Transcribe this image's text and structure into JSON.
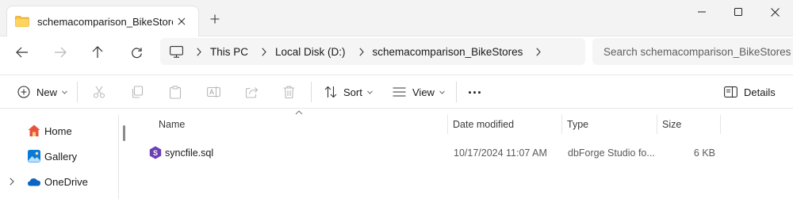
{
  "window": {
    "tab_title": "schemacomparison_BikeStores",
    "new_tab_symbol": "+",
    "tab_close_symbol": "✕"
  },
  "address": {
    "crumbs": [
      "This PC",
      "Local Disk (D:)",
      "schemacomparison_BikeStores"
    ],
    "search_placeholder": "Search schemacomparison_BikeStores"
  },
  "toolbar": {
    "new_label": "New",
    "sort_label": "Sort",
    "view_label": "View",
    "more_label": "...",
    "details_label": "Details"
  },
  "nav": {
    "items": [
      {
        "label": "Home",
        "icon": "home-icon"
      },
      {
        "label": "Gallery",
        "icon": "gallery-icon"
      },
      {
        "label": "OneDrive",
        "icon": "onedrive-icon"
      }
    ]
  },
  "list": {
    "columns": [
      "Name",
      "Date modified",
      "Type",
      "Size"
    ],
    "rows": [
      {
        "name": "syncfile.sql",
        "date": "10/17/2024 11:07 AM",
        "type": "dbForge Studio fo...",
        "size": "6 KB",
        "icon": "dbforge-file-icon"
      }
    ]
  },
  "colors": {
    "folder": "#f6c244",
    "accent": "#0067c0",
    "dbforge": "#6b3fb3",
    "onedrive": "#0a64c4"
  }
}
